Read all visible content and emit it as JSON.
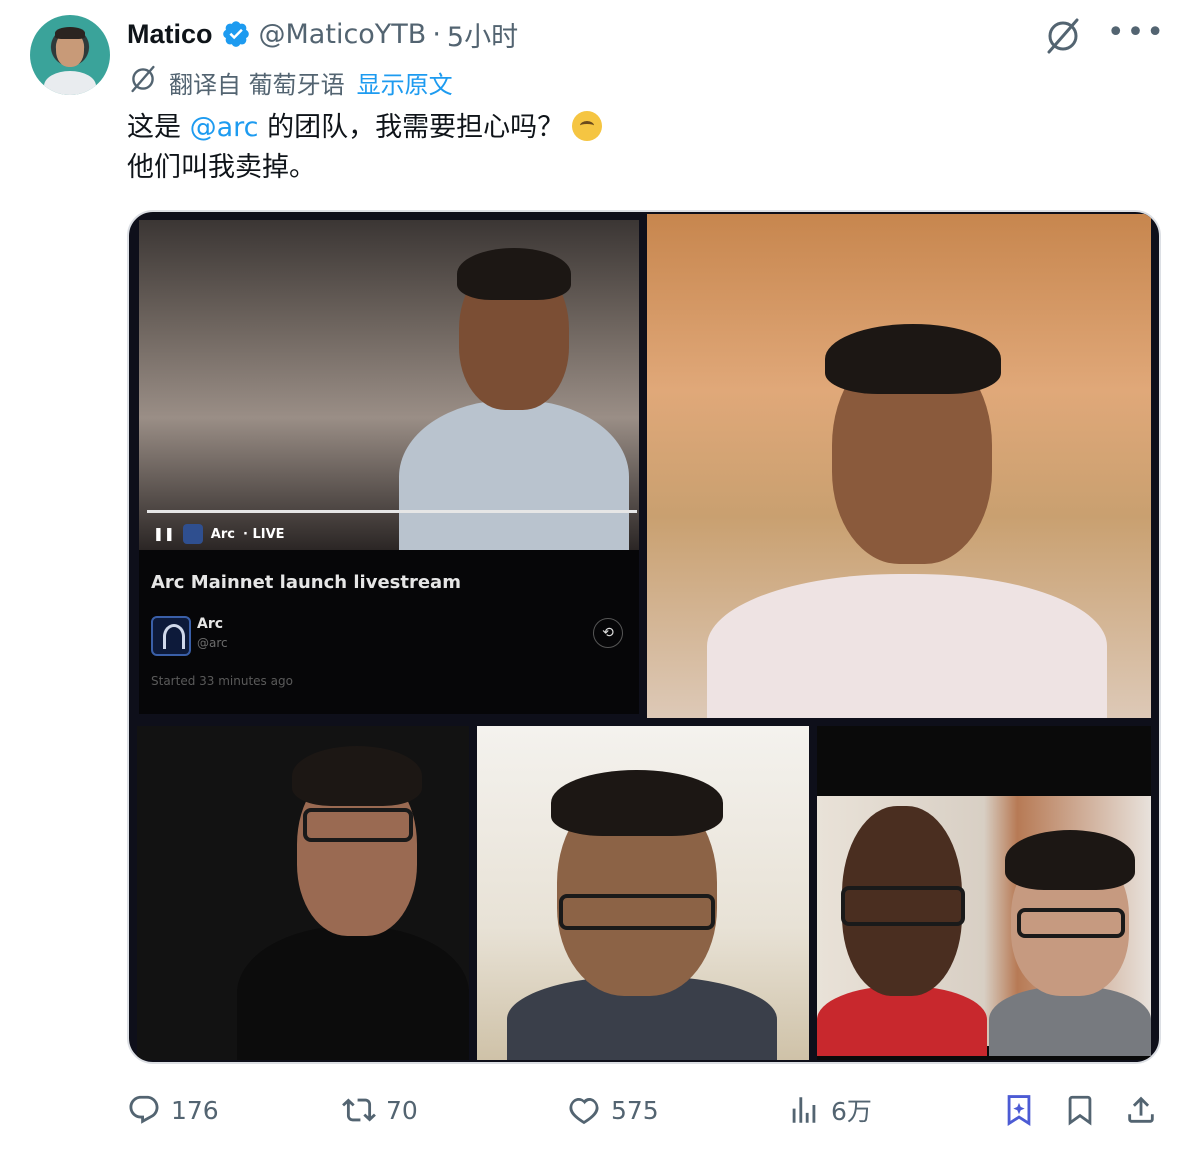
{
  "author": {
    "name": "Matico",
    "handle": "@MaticoYTB",
    "separator": "·",
    "time": "5小时"
  },
  "translation": {
    "label": "翻译自 葡萄牙语",
    "show_original": "显示原文"
  },
  "tweet": {
    "line1_before": "这是 ",
    "mention": "@arc",
    "line1_after": " 的团队，我需要担心吗？",
    "line2": "他们叫我卖掉。"
  },
  "media": {
    "video_overlay": {
      "brand": "Arc",
      "live_label": "· LIVE",
      "stream_title": "Arc Mainnet launch livestream",
      "account_name": "Arc",
      "account_handle": "@arc",
      "started": "Started 33 minutes ago"
    }
  },
  "actions": {
    "replies": "176",
    "reposts": "70",
    "likes": "575",
    "views": "6万"
  },
  "colors": {
    "accent": "#1d9bf0",
    "muted": "#536471",
    "grok_active": "#4c5bd4"
  },
  "icons": [
    "verified-badge-icon",
    "grok-icon",
    "more-icon",
    "translate-icon",
    "reply-icon",
    "retweet-icon",
    "like-icon",
    "views-icon",
    "grok-action-icon",
    "bookmark-icon",
    "share-icon"
  ]
}
